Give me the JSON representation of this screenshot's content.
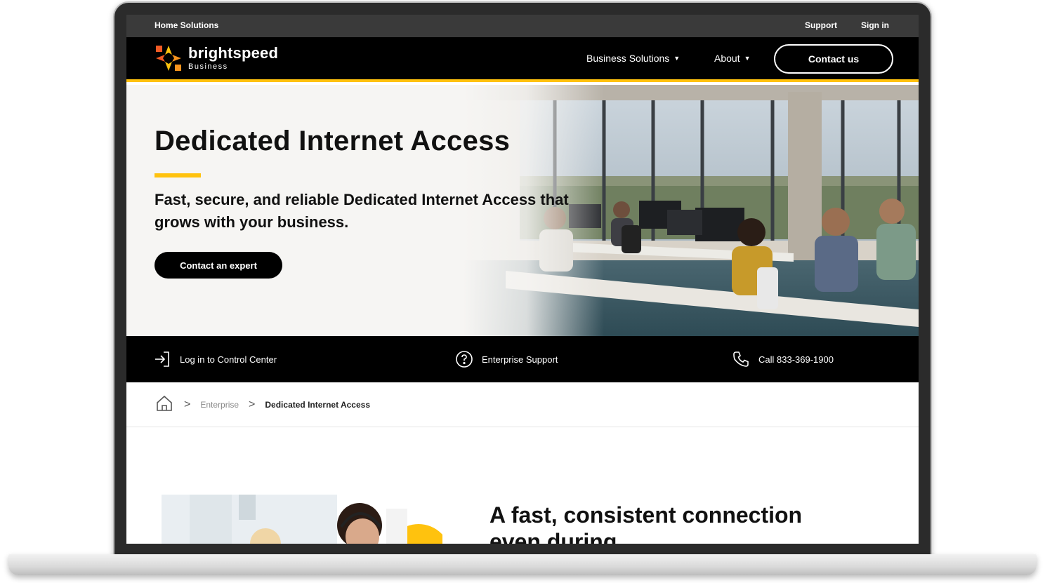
{
  "utility_bar": {
    "home_solutions": "Home Solutions",
    "support": "Support",
    "sign_in": "Sign in"
  },
  "logo": {
    "brand": "brightspeed",
    "sub": "Business"
  },
  "nav": {
    "items": [
      {
        "label": "Business Solutions",
        "has_dropdown": true
      },
      {
        "label": "About",
        "has_dropdown": true
      }
    ],
    "contact_label": "Contact us"
  },
  "hero": {
    "title": "Dedicated Internet Access",
    "subtitle": "Fast, secure, and reliable Dedicated Internet Access that grows with your business.",
    "cta_label": "Contact an expert"
  },
  "quick_links": [
    {
      "icon": "login-icon",
      "label": "Log in to Control Center"
    },
    {
      "icon": "question-circle-icon",
      "label": "Enterprise Support"
    },
    {
      "icon": "phone-icon",
      "label": "Call 833-369-1900"
    }
  ],
  "breadcrumb": {
    "home_icon": "home-icon",
    "items": [
      "Enterprise",
      "Dedicated Internet Access"
    ]
  },
  "content": {
    "heading": "A fast, consistent connection even during"
  },
  "colors": {
    "accent": "#ffc20e",
    "nav_bg": "#000000",
    "utility_bg": "#3a3a3a",
    "hero_bg": "#f6f5f3"
  }
}
